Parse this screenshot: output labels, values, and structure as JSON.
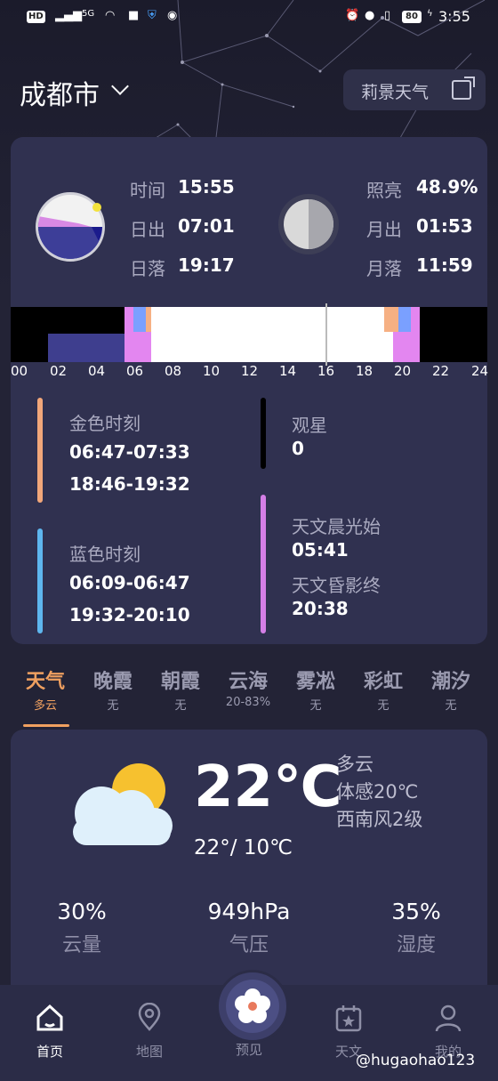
{
  "status_bar": {
    "left": [
      "HD",
      "5G"
    ],
    "battery": "80",
    "time": "3:55"
  },
  "header": {
    "city": "成都市",
    "brand_button": "莉景天气"
  },
  "sun_panel": {
    "time_label": "时间",
    "time_value": "15:55",
    "sunrise_label": "日出",
    "sunrise_value": "07:01",
    "sunset_label": "日落",
    "sunset_value": "19:17"
  },
  "moon_panel": {
    "illum_label": "照亮",
    "illum_value": "48.9%",
    "moonrise_label": "月出",
    "moonrise_value": "01:53",
    "moonset_label": "月落",
    "moonset_value": "11:59"
  },
  "timeline": {
    "hours": [
      "00",
      "02",
      "04",
      "06",
      "08",
      "10",
      "12",
      "14",
      "16",
      "18",
      "20",
      "22",
      "24"
    ],
    "colors": {
      "night": "#000000",
      "astro": "#e386f0",
      "blue": "#7aa0ff",
      "golden": "#f6b083",
      "day": "#ffffff",
      "deep": "#3e3e8e"
    }
  },
  "golden_hour": {
    "label": "金色时刻",
    "morning": "06:47-07:33",
    "evening": "18:46-19:32",
    "color": "#f2a77a"
  },
  "stargazing": {
    "label": "观星",
    "value": "0",
    "color": "#000000"
  },
  "blue_hour": {
    "label": "蓝色时刻",
    "morning": "06:09-06:47",
    "evening": "19:32-20:10",
    "color": "#5eb6ee"
  },
  "astro_twilight": {
    "start_label": "天文晨光始",
    "start_value": "05:41",
    "end_label": "天文昏影终",
    "end_value": "20:38",
    "color": "#d47fe6"
  },
  "tabs": [
    {
      "title": "天气",
      "sub": "多云",
      "active": true
    },
    {
      "title": "晚霞",
      "sub": "无"
    },
    {
      "title": "朝霞",
      "sub": "无"
    },
    {
      "title": "云海",
      "sub": "20-83%"
    },
    {
      "title": "雾凇",
      "sub": "无"
    },
    {
      "title": "彩虹",
      "sub": "无"
    },
    {
      "title": "潮汐",
      "sub": "无"
    }
  ],
  "weather": {
    "temp": "22℃",
    "condition": "多云",
    "feels_like": "体感20℃",
    "wind": "西南风2级",
    "range": "22°/ 10℃",
    "stats": [
      {
        "value": "30%",
        "label": "云量"
      },
      {
        "value": "949hPa",
        "label": "气压"
      },
      {
        "value": "35%",
        "label": "湿度"
      }
    ]
  },
  "nav": [
    {
      "label": "首页",
      "icon": "home-icon",
      "active": true
    },
    {
      "label": "地图",
      "icon": "map-pin-icon"
    },
    {
      "label": "预见",
      "icon": "flower-icon"
    },
    {
      "label": "天文",
      "icon": "calendar-star-icon"
    },
    {
      "label": "我的",
      "icon": "user-icon"
    }
  ],
  "watermark": "@hugaohao123"
}
